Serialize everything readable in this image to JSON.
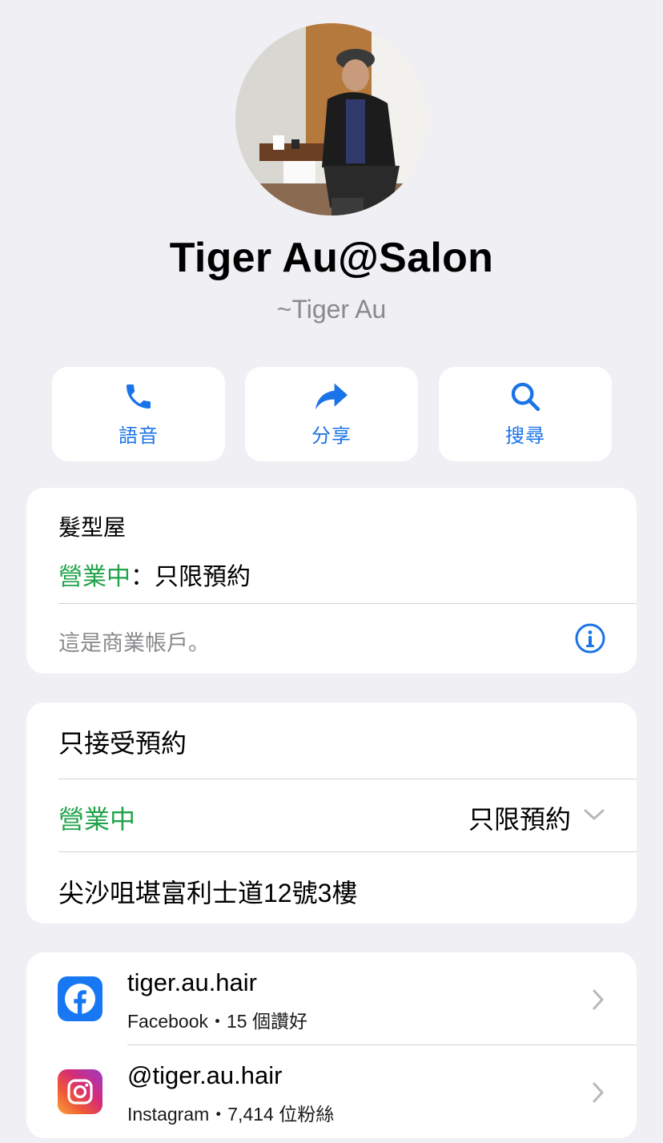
{
  "profile": {
    "name": "Tiger Au@Salon",
    "subname": "~Tiger Au"
  },
  "actions": [
    {
      "label": "語音",
      "icon": "phone-icon"
    },
    {
      "label": "分享",
      "icon": "share-icon"
    },
    {
      "label": "搜尋",
      "icon": "search-icon"
    }
  ],
  "business": {
    "category": "髮型屋",
    "status": "營業中",
    "status_detail": "：只限預約",
    "note": "這是商業帳戶。",
    "info_icon": "info-icon"
  },
  "hours": {
    "description": "只接受預約",
    "status": "營業中",
    "value": "只限預約",
    "address": "尖沙咀堪富利士道12號3樓"
  },
  "links": [
    {
      "title": "tiger.au.hair",
      "subtitle": "Facebook・15 個讚好",
      "icon": "facebook-icon"
    },
    {
      "title": "@tiger.au.hair",
      "subtitle": "Instagram・7,414 位粉絲",
      "icon": "instagram-icon"
    }
  ],
  "colors": {
    "background": "#efeff4",
    "accent": "#1a73e8",
    "open_status": "#21a34a",
    "facebook": "#1877f2"
  }
}
